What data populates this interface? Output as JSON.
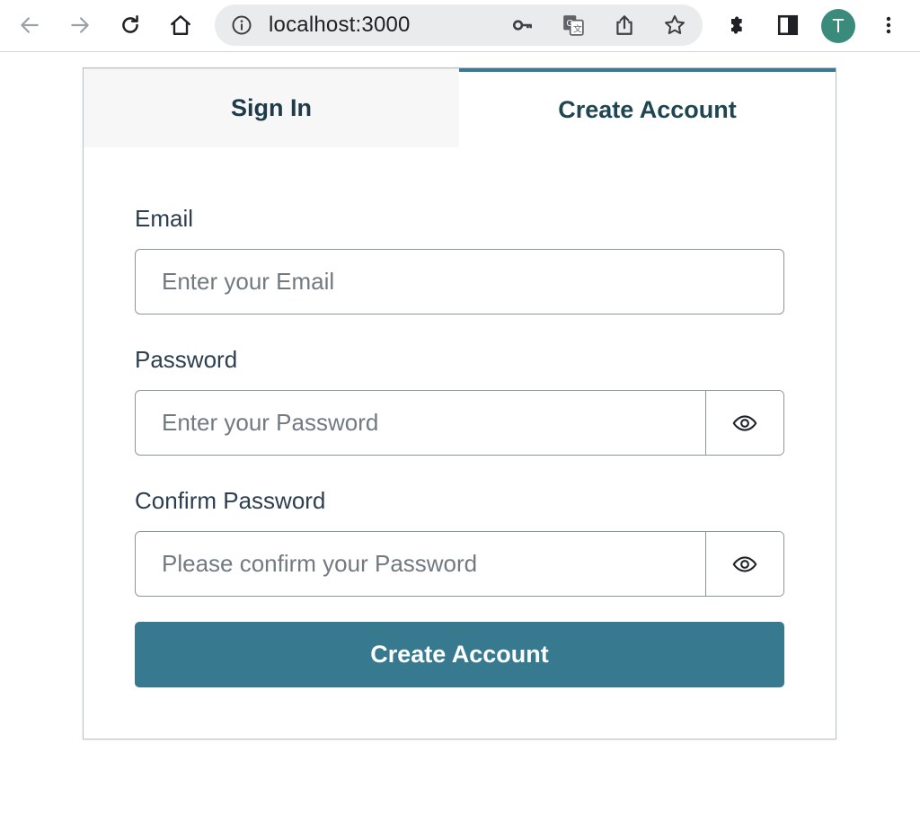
{
  "browser": {
    "url": "localhost:3000",
    "profile_initial": "T",
    "icons": [
      "back-icon",
      "forward-icon",
      "reload-icon",
      "home-icon",
      "site-info-icon",
      "password-key-icon",
      "translate-icon",
      "share-icon",
      "bookmark-star-icon",
      "extensions-icon",
      "side-panel-icon",
      "menu-icon"
    ]
  },
  "auth": {
    "tabs": [
      {
        "label": "Sign In",
        "active": false
      },
      {
        "label": "Create Account",
        "active": true
      }
    ],
    "email": {
      "label": "Email",
      "placeholder": "Enter your Email",
      "value": ""
    },
    "password": {
      "label": "Password",
      "placeholder": "Enter your Password",
      "value": ""
    },
    "confirm_password": {
      "label": "Confirm Password",
      "placeholder": "Please confirm your Password",
      "value": ""
    },
    "submit_label": "Create Account"
  },
  "colors": {
    "accent": "#377a8f",
    "text": "#2c3e50",
    "avatar": "#3a8b7c"
  }
}
